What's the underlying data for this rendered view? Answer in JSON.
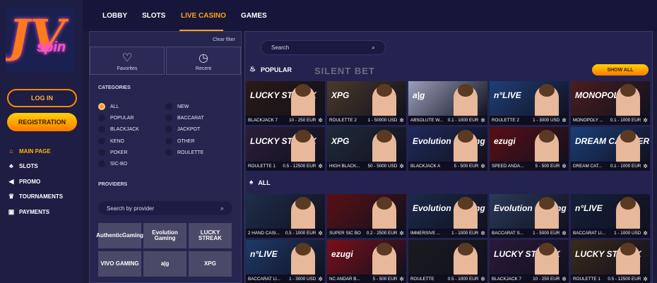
{
  "brand": {
    "logo_text": "JV",
    "logo_sub": "spin"
  },
  "auth": {
    "login_label": "LOG IN",
    "register_label": "REGISTRATION"
  },
  "sidebar": {
    "items": [
      {
        "label": "MAIN PAGE",
        "icon": "home-icon",
        "active": true
      },
      {
        "label": "SLOTS",
        "icon": "cherries-icon",
        "active": false
      },
      {
        "label": "PROMO",
        "icon": "megaphone-icon",
        "active": false
      },
      {
        "label": "TOURNAMENTS",
        "icon": "trophy-icon",
        "active": false
      },
      {
        "label": "PAYMENTS",
        "icon": "wallet-icon",
        "active": false
      }
    ]
  },
  "topnav": {
    "tabs": [
      {
        "label": "LOBBY"
      },
      {
        "label": "SLOTS"
      },
      {
        "label": "LIVE CASINO",
        "active": true
      },
      {
        "label": "GAMES"
      }
    ]
  },
  "filters": {
    "clear_label": "Clear filter",
    "favorites_label": "Favorites",
    "recent_label": "Recent",
    "categories_title": "CATEGORIES",
    "categories_left": [
      "ALL",
      "POPULAR",
      "BLACKJACK",
      "KENO",
      "POKER",
      "SIC-BO"
    ],
    "categories_right": [
      "NEW",
      "BACCARAT",
      "JACKPOT",
      "OTHER",
      "ROULETTE"
    ],
    "selected_category": "ALL",
    "providers_title": "PROVIDERS",
    "provider_search_placeholder": "Search by provider",
    "providers": [
      "AuthenticGaming",
      "Evolution Gaming",
      "LUCKY STREAK",
      "VIVO GAMING",
      "a|g",
      "XPG"
    ]
  },
  "main": {
    "search_placeholder": "Search",
    "popular_title": "POPULAR",
    "show_all_label": "SHOW ALL",
    "all_title": "ALL",
    "watermark": "SILENT BET"
  },
  "popular_row1": [
    {
      "name": "BLACKJACK 7",
      "limit": "10 - 250 EUR",
      "brand": "LUCKY STREAK"
    },
    {
      "name": "ROULETTE 2",
      "limit": "1 - 50000 USD",
      "brand": "XPG"
    },
    {
      "name": "ABSOLUTE W...",
      "limit": "0.1 - 1000 EUR",
      "brand": "a|g"
    },
    {
      "name": "ROULETTE 2",
      "limit": "1 - 3000 USD",
      "brand": "n°LIVE"
    },
    {
      "name": "MONOPOLY ...",
      "limit": "0.1 - 1000 EUR",
      "brand": "MONOPOLY"
    }
  ],
  "popular_row2": [
    {
      "name": "ROULETTE 1",
      "limit": "0.5 - 12500 EUR",
      "brand": "LUCKY STREAK"
    },
    {
      "name": "HIGH BLACK...",
      "limit": "50 - 5000 USD",
      "brand": "XPG"
    },
    {
      "name": "BLACKJACK A",
      "limit": "5 - 500 EUR",
      "brand": "Evolution Gaming"
    },
    {
      "name": "SPEED ANDA...",
      "limit": "5 - 500 EUR",
      "brand": "ezugi"
    },
    {
      "name": "DREAM CAT...",
      "limit": "0.1 - 1000 EUR",
      "brand": "DREAM CATCHER"
    }
  ],
  "all_row1": [
    {
      "name": "2 HAND CASI...",
      "limit": "0.5 - 1000 EUR",
      "brand": ""
    },
    {
      "name": "SUPER SIC BO",
      "limit": "0.2 - 2500 EUR",
      "brand": ""
    },
    {
      "name": "IMMERSIVE ...",
      "limit": "1 - 1000 EUR",
      "brand": "Evolution Gaming"
    },
    {
      "name": "BACCARAT S...",
      "limit": "1 - 5000 EUR",
      "brand": "Evolution Gaming"
    },
    {
      "name": "BACCARAT LI...",
      "limit": "1 - 1000 USD",
      "brand": "n°LIVE"
    }
  ],
  "all_row2": [
    {
      "name": "BACCARAT LI...",
      "limit": "1 - 3000 USD",
      "brand": "n°LIVE"
    },
    {
      "name": "NC ANDAR B...",
      "limit": "5 - 500 EUR",
      "brand": "ezugi"
    },
    {
      "name": "ROULETTE",
      "limit": "0.5 - 1000 EUR",
      "brand": ""
    },
    {
      "name": "BLACKJACK 7",
      "limit": "10 - 250 EUR",
      "brand": "LUCKY STREAK"
    },
    {
      "name": "ROULETTE 1",
      "limit": "0.5 - 12500 EUR",
      "brand": "LUCKY STREAK"
    }
  ],
  "colors": {
    "accent": "#ffa21a",
    "bg": "#1b1a3a",
    "panel": "#242350"
  }
}
